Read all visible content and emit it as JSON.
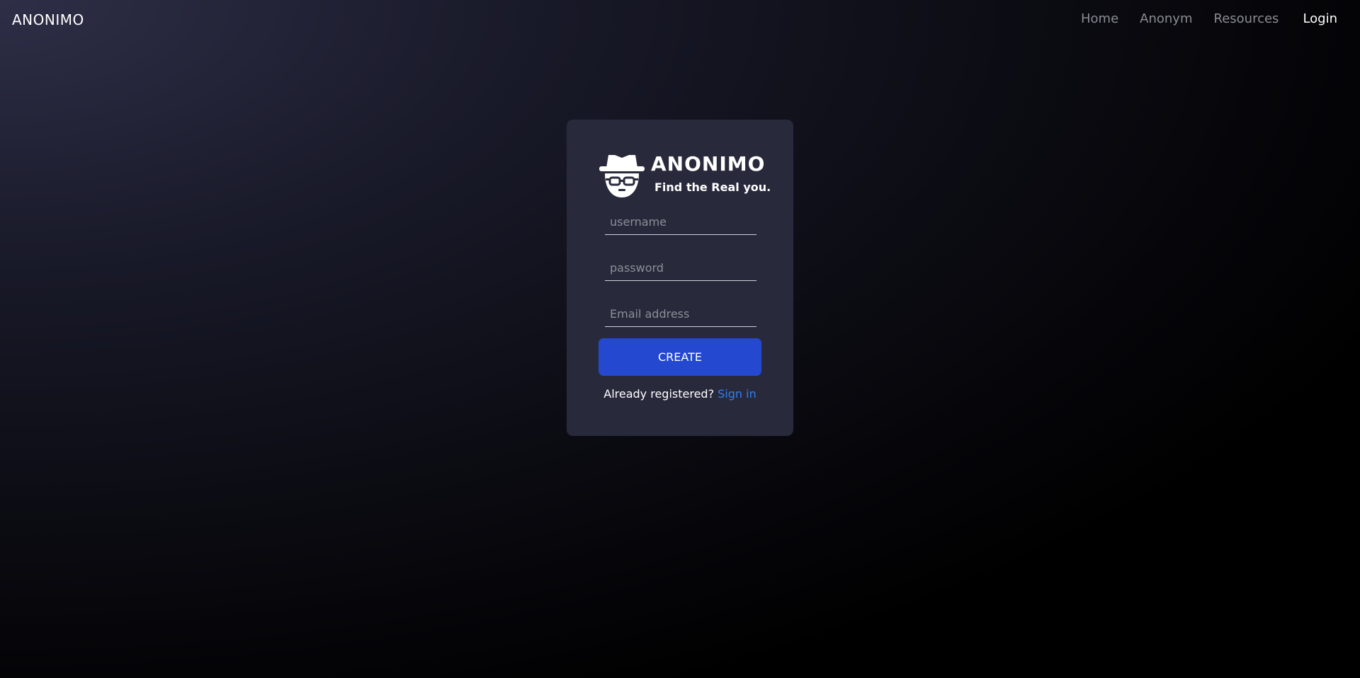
{
  "navbar": {
    "brand": "ANONIMO",
    "links": [
      {
        "label": "Home"
      },
      {
        "label": "Anonym"
      },
      {
        "label": "Resources"
      },
      {
        "label": "Login"
      }
    ]
  },
  "card": {
    "logo": {
      "icon": "incognito-hat-glasses-icon",
      "name": "ANONIMO",
      "tagline": "Find the Real you."
    },
    "form": {
      "username_placeholder": "username",
      "password_placeholder": "password",
      "email_placeholder": "Email address",
      "submit_label": "CREATE"
    },
    "footer": {
      "prompt": "Already registered?",
      "link_label": "Sign in"
    }
  },
  "colors": {
    "button": "#2449d0",
    "link": "#2f7ff0",
    "card": "#282a3c"
  }
}
